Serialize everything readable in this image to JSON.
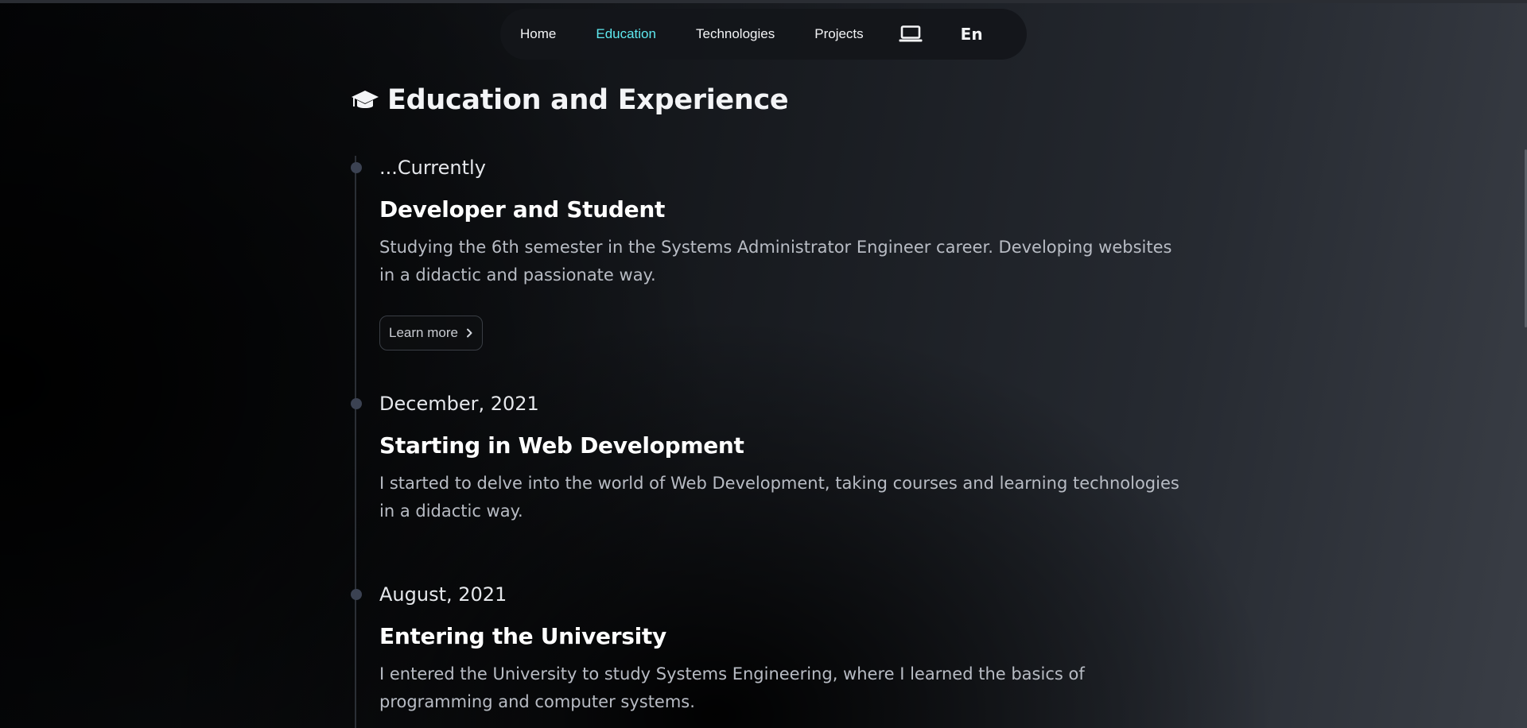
{
  "nav": {
    "items": [
      {
        "label": "Home",
        "active": false
      },
      {
        "label": "Education",
        "active": true
      },
      {
        "label": "Technologies",
        "active": false
      },
      {
        "label": "Projects",
        "active": false
      }
    ],
    "theme_icon": "laptop-icon",
    "language": "En"
  },
  "section": {
    "icon": "graduation-cap-icon",
    "title": "Education and Experience"
  },
  "timeline": [
    {
      "date": "...Currently",
      "title": "Developer and Student",
      "description": "Studying the 6th semester in the Systems Administrator Engineer career. Developing websites in a didactic and passionate way.",
      "button_label": "Learn more"
    },
    {
      "date": "December, 2021",
      "title": "Starting in Web Development",
      "description": "I started to delve into the world of Web Development, taking courses and learning technologies in a didactic way."
    },
    {
      "date": "August, 2021",
      "title": "Entering the University",
      "description": "I entered the University to study Systems Engineering, where I learned the basics of programming and computer systems."
    }
  ],
  "colors": {
    "accent": "#5ee9f0",
    "text": "#f3f4f6",
    "muted": "#b8bcc4",
    "dot": "#3b4252"
  }
}
